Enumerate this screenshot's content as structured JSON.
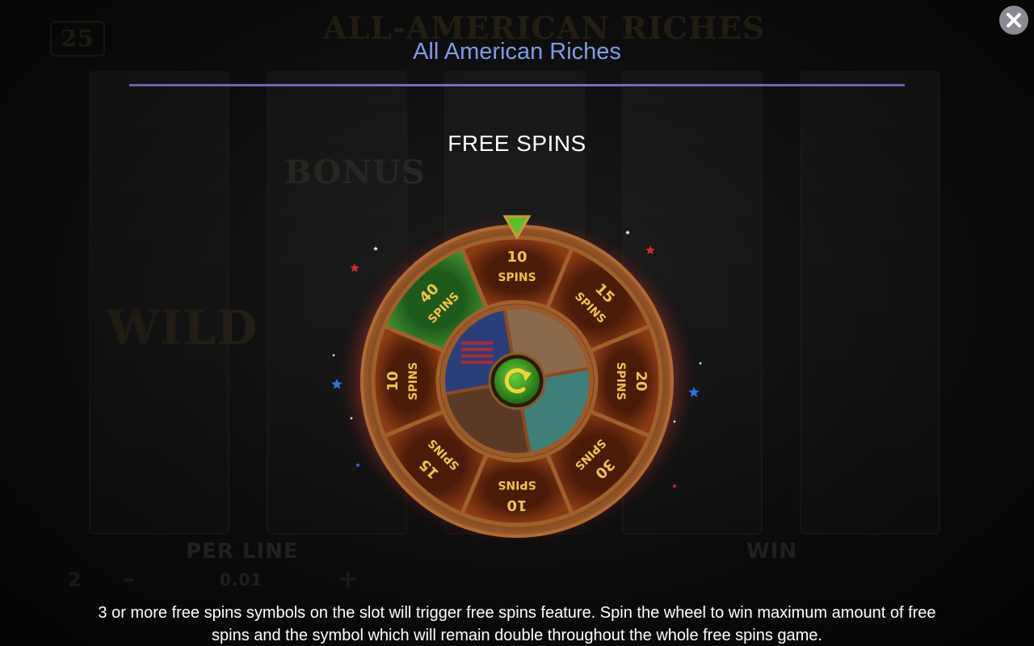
{
  "header": {
    "title": "All American Riches",
    "close_icon": "close-icon"
  },
  "section": {
    "heading": "FREE SPINS",
    "description": "3 or more free spins symbols on the slot will trigger free spins feature. Spin the wheel to win maximum amount of free spins and the symbol which will remain double throughout the whole free spins game."
  },
  "wheel": {
    "segments": [
      {
        "number": "10",
        "word": "SPINS",
        "highlighted": false
      },
      {
        "number": "15",
        "word": "SPINS",
        "highlighted": false
      },
      {
        "number": "20",
        "word": "SPINS",
        "highlighted": false
      },
      {
        "number": "30",
        "word": "SPINS",
        "highlighted": false
      },
      {
        "number": "10",
        "word": "SPINS",
        "highlighted": false
      },
      {
        "number": "15",
        "word": "SPINS",
        "highlighted": false
      },
      {
        "number": "10",
        "word": "SPINS",
        "highlighted": false
      },
      {
        "number": "40",
        "word": "SPINS",
        "highlighted": true
      }
    ],
    "inner_symbols": [
      "cowboy-hat-icon",
      "statue-of-liberty-icon",
      "bison-icon",
      "american-flag-icon"
    ],
    "center_icon": "spin-arrow-icon",
    "pointer_icon": "pointer-triangle-icon",
    "colors": {
      "segment": "#6b2c10",
      "segment_highlight": "#2f7a2a",
      "rim": "#8a4a22",
      "label": "#f2c24a",
      "center": "#3fa62b"
    }
  },
  "background_game": {
    "title": "ALL-AMERICAN RICHES",
    "lines": "25",
    "bonus": "BONUS",
    "wild": "WILD",
    "per_line_label": "PER LINE",
    "per_line_value": "0.01",
    "win_label": "WIN",
    "lines_value": "2",
    "minus": "–",
    "plus": "+"
  }
}
